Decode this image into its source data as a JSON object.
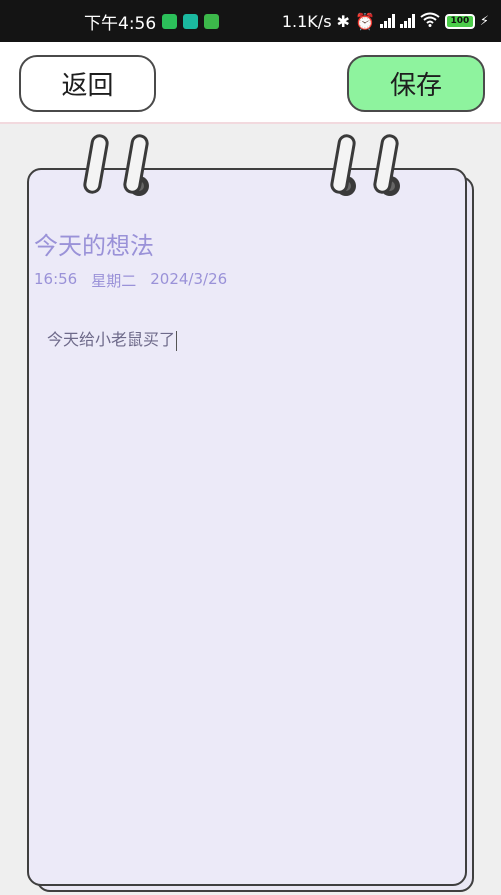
{
  "status_bar": {
    "time": "下午4:56",
    "network_speed": "1.1K/s",
    "battery": "100",
    "icons": [
      "wechat-icon",
      "app-icon",
      "app-icon",
      "bluetooth-icon",
      "alarm-icon",
      "signal-icon",
      "signal-icon",
      "wifi-icon",
      "battery-icon",
      "charging-icon"
    ]
  },
  "toolbar": {
    "back_label": "返回",
    "save_label": "保存",
    "save_color": "#8ef39e"
  },
  "note": {
    "title": "今天的想法",
    "time": "16:56",
    "weekday": "星期二",
    "date": "2024/3/26",
    "content": "今天给小老鼠买了"
  }
}
